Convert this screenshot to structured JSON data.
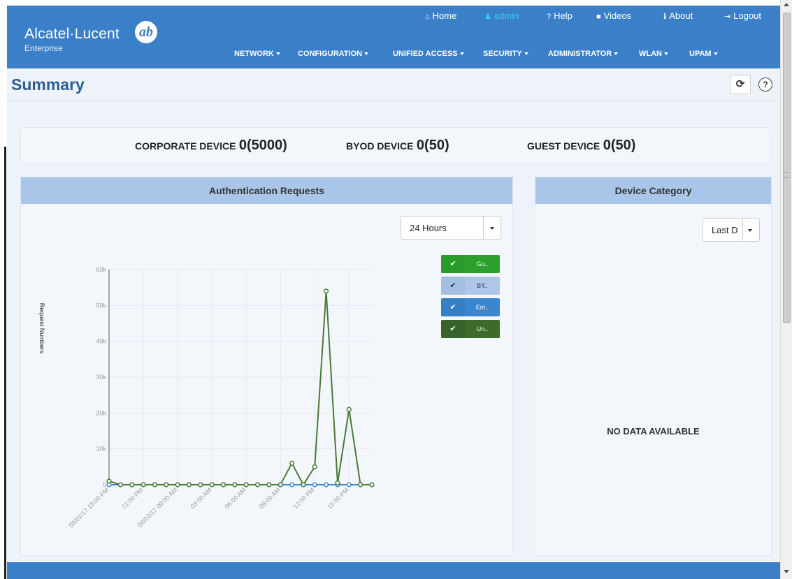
{
  "brand": {
    "name": "Alcatel·Lucent",
    "sub": "Enterprise",
    "mark": "ab"
  },
  "util_nav": [
    {
      "icon": "home-icon",
      "glyph": "⌂",
      "label": "Home"
    },
    {
      "icon": "user-icon",
      "glyph": "♟",
      "label": "admin"
    },
    {
      "icon": "help-icon",
      "glyph": "?",
      "label": "Help"
    },
    {
      "icon": "video-icon",
      "glyph": "■",
      "label": "Videos"
    },
    {
      "icon": "info-icon",
      "glyph": "ℹ",
      "label": "About"
    },
    {
      "icon": "logout-icon",
      "glyph": "⇥",
      "label": "Logout"
    }
  ],
  "main_nav": [
    "NETWORK",
    "CONFIGURATION",
    "UNIFIED ACCESS",
    "SECURITY",
    "ADMINISTRATOR",
    "WLAN",
    "UPAM"
  ],
  "page": {
    "title": "Summary",
    "refresh_glyph": "⟳",
    "help_glyph": "?"
  },
  "stats": [
    {
      "label": "CORPORATE DEVICE",
      "value": "0(5000)"
    },
    {
      "label": "BYOD DEVICE",
      "value": "0(50)"
    },
    {
      "label": "GUEST DEVICE",
      "value": "0(50)"
    }
  ],
  "auth_panel": {
    "title": "Authentication Requests",
    "range_select": "24 Hours",
    "legend": [
      {
        "label": "Gu..",
        "color": "#2ca02c",
        "check": "✔"
      },
      {
        "label": "BY..",
        "color": "#aec7e8",
        "check": "✔"
      },
      {
        "label": "Em..",
        "color": "#3a87d0",
        "check": "✔"
      },
      {
        "label": "Un..",
        "color": "#3d6b2c",
        "check": "✔"
      }
    ]
  },
  "device_panel": {
    "title": "Device Category",
    "range_select": "Last D",
    "empty_text": "NO DATA AVAILABLE"
  },
  "chart_data": {
    "type": "line",
    "title": "",
    "xlabel": "",
    "ylabel": "Request Numbers",
    "ylim": [
      0,
      60000
    ],
    "yticks": [
      "0",
      "10k",
      "20k",
      "30k",
      "40k",
      "50k",
      "60k"
    ],
    "xticks": [
      "08/01/17 18:00 PM",
      "21:00 PM",
      "08/02/17 00:00 AM",
      "03:00 AM",
      "06:00 AM",
      "09:00 AM",
      "12:00 PM",
      "15:00 PM"
    ],
    "hours": [
      "18:00",
      "19:00",
      "20:00",
      "21:00",
      "22:00",
      "23:00",
      "00:00",
      "01:00",
      "02:00",
      "03:00",
      "04:00",
      "05:00",
      "06:00",
      "07:00",
      "08:00",
      "09:00",
      "10:00",
      "11:00",
      "12:00",
      "13:00",
      "14:00",
      "15:00",
      "16:00",
      "17:00"
    ],
    "series": [
      {
        "name": "Un..",
        "color": "#4a7a36",
        "values": [
          1000,
          0,
          0,
          0,
          0,
          0,
          0,
          0,
          0,
          0,
          0,
          0,
          0,
          0,
          0,
          0,
          6000,
          0,
          5000,
          54000,
          500,
          21000,
          0,
          0
        ]
      },
      {
        "name": "Em..",
        "color": "#3a87d0",
        "values": [
          0,
          0,
          0,
          0,
          0,
          0,
          0,
          0,
          0,
          0,
          0,
          0,
          0,
          0,
          0,
          0,
          0,
          0,
          0,
          0,
          0,
          0,
          0,
          0
        ]
      }
    ],
    "grid": true
  }
}
